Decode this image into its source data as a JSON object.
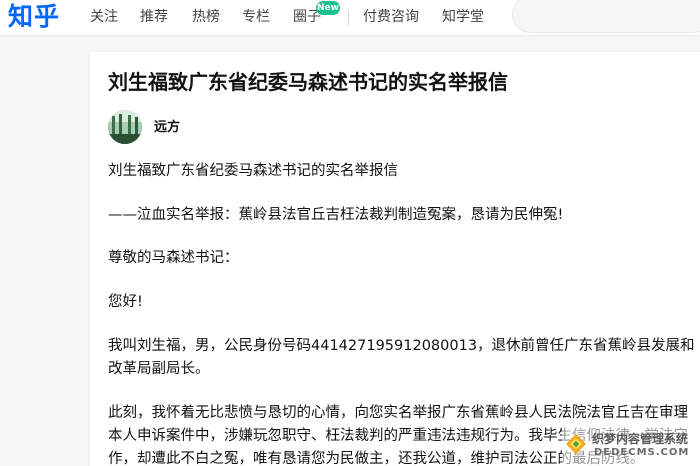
{
  "header": {
    "logo": "知乎",
    "nav": [
      "关注",
      "推荐",
      "热榜",
      "专栏",
      "圈子",
      "付费咨询",
      "知学堂"
    ],
    "new_badge": "New"
  },
  "article": {
    "title": "刘生福致广东省纪委马森述书记的实名举报信",
    "author": "远方",
    "paragraphs": [
      "刘生福致广东省纪委马森述书记的实名举报信",
      "——泣血实名举报：蕉岭县法官丘吉枉法裁判制造冤案，恳请为民伸冤!",
      "尊敬的马森述书记：",
      "您好!",
      "我叫刘生福，男，公民身份号码441427195912080013，退休前曾任广东省蕉岭县发展和改革局副局长。",
      "此刻，我怀着无比悲愤与恳切的心情，向您实名举报广东省蕉岭县人民法院法官丘吉在审理本人申诉案件中，涉嫌玩忽职守、枉法裁判的严重违法违规行为。我毕生信仰法律，学法守作，却遭此不白之冤，唯有恳请您为民做主，还我公道，维护司法公正的最后防线。"
    ]
  },
  "watermark": {
    "cn": "织梦内容管理系统",
    "en": "DEDECMS.COM"
  },
  "colors": {
    "brand": "#0066ff",
    "badge": "#1fbf8f"
  }
}
